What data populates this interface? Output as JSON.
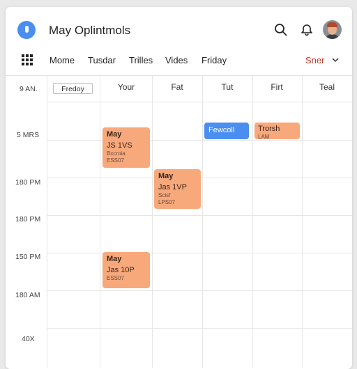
{
  "header": {
    "title": "May Oplintmols",
    "icons": [
      "search-icon",
      "bell-icon"
    ],
    "accent": "#4a8ef0"
  },
  "nav": {
    "tabs": [
      "Mome",
      "Tusdar",
      "Trilles",
      "Vides",
      "Friday"
    ],
    "select_label": "Sner",
    "select_color": "#c0392b"
  },
  "calendar": {
    "day_button": "Fredoy",
    "days": [
      "Your",
      "Fat",
      "Tut",
      "Firt",
      "Teal"
    ],
    "times": [
      "9 AN.",
      "5 MRS",
      "180 PM",
      "180 PM",
      "150 PM",
      "180 AM",
      "40X"
    ],
    "events": [
      {
        "title": "May",
        "time": "JS 1VS",
        "line1": "Bxcroia",
        "line2": "ESS07"
      },
      {
        "title": "May",
        "time": "Jas 1VP",
        "line1": "Scisf",
        "line2": "LPS07"
      },
      {
        "title": "May",
        "time": "Jas 10P",
        "line1": "ESS07"
      },
      {
        "title": "Fewcoll"
      },
      {
        "title": "Trorsh",
        "line1": "LAM"
      }
    ],
    "event_color": "#f7a97c",
    "blue_event_color": "#4a8ef0"
  }
}
